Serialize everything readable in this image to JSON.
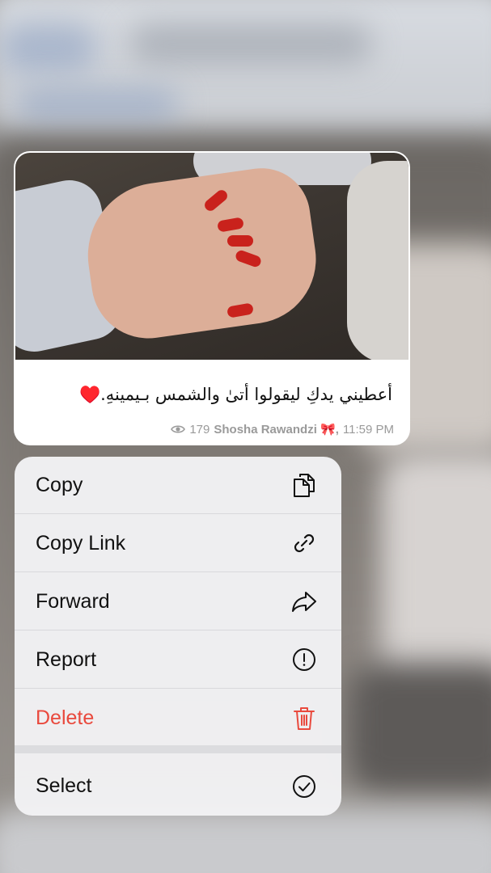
{
  "message": {
    "caption": "أعطيني يدكِ ليقولوا أتىٰ والشمس بـيمينهِ.♥️",
    "views": "179",
    "author": "Shosha Rawandzi 🎀,",
    "time": "11:59 PM"
  },
  "menu": {
    "items": [
      {
        "label": "Copy",
        "icon": "copy-icon"
      },
      {
        "label": "Copy Link",
        "icon": "link-icon"
      },
      {
        "label": "Forward",
        "icon": "forward-icon"
      },
      {
        "label": "Report",
        "icon": "report-icon"
      },
      {
        "label": "Delete",
        "icon": "trash-icon",
        "color": "#e9493d"
      },
      {
        "label": "Select",
        "icon": "select-check-icon"
      }
    ]
  }
}
